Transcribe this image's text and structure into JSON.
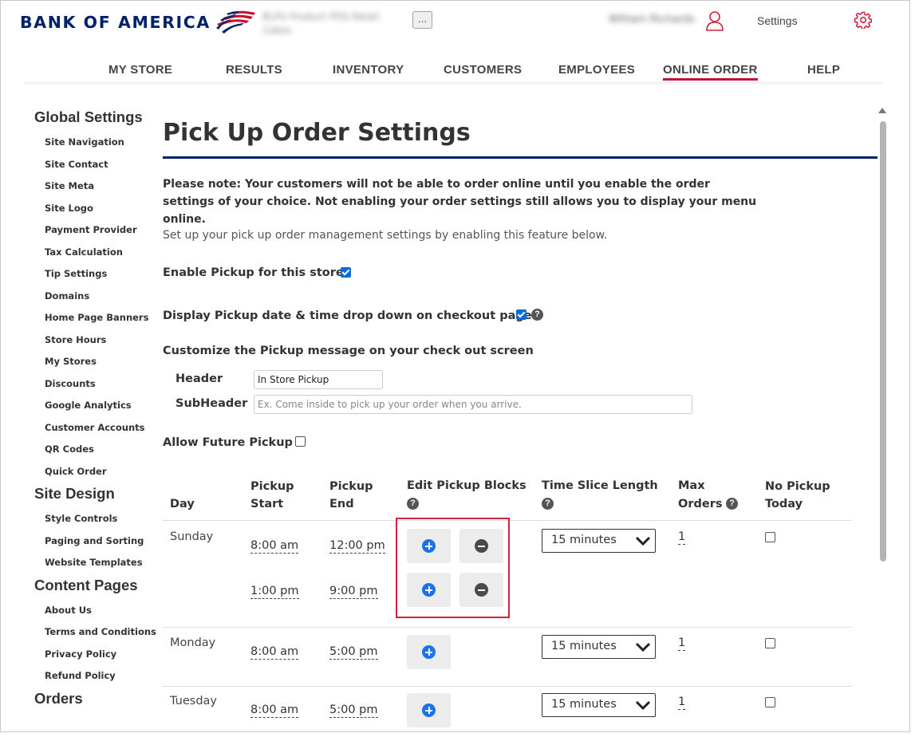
{
  "header": {
    "logo_text": "BANK OF AMERICA",
    "store_name": "BLPU Product POS Retail Cakes",
    "menu_button": "...",
    "user_name": "William Richards",
    "settings_label": "Settings",
    "brand_blue": "#012169",
    "brand_red": "#c41230"
  },
  "topnav": {
    "items": [
      "MY STORE",
      "RESULTS",
      "INVENTORY",
      "CUSTOMERS",
      "EMPLOYEES",
      "ONLINE ORDER",
      "HELP"
    ],
    "active": "ONLINE ORDER"
  },
  "sidebar": {
    "global_settings": {
      "title": "Global Settings",
      "links": [
        "Site Navigation",
        "Site Contact",
        "Site Meta",
        "Site Logo",
        "Payment Provider",
        "Tax Calculation",
        "Tip Settings",
        "Domains",
        "Home Page Banners",
        "Store Hours",
        "My Stores",
        "Discounts",
        "Google Analytics",
        "Customer Accounts",
        "QR Codes",
        "Quick Order"
      ]
    },
    "site_design": {
      "title": "Site Design",
      "links": [
        "Style Controls",
        "Paging and Sorting",
        "Website Templates"
      ]
    },
    "content_pages": {
      "title": "Content Pages",
      "links": [
        "About Us",
        "Terms and Conditions",
        "Privacy Policy",
        "Refund Policy"
      ]
    },
    "orders": {
      "title": "Orders"
    }
  },
  "main": {
    "title": "Pick Up Order Settings",
    "note": "Please note: Your customers will not be able to order online until you enable the order settings of your choice. Not enabling your order settings still allows you to display your menu online.",
    "setup_text": "Set up your pick up order management settings by enabling this feature below.",
    "enable_pickup": {
      "label": "Enable Pickup for this store?",
      "checked": true
    },
    "display_dropdown": {
      "label": "Display Pickup date & time drop down on checkout page?",
      "checked": true
    },
    "customize_label": "Customize the Pickup message on your check out screen",
    "header_field": {
      "label": "Header",
      "value": "In Store Pickup"
    },
    "subheader_field": {
      "label": "SubHeader",
      "placeholder": "Ex. Come inside to pick up your order when you arrive."
    },
    "future_pickup": {
      "label": "Allow Future Pickup",
      "checked": false
    },
    "help_glyph": "?"
  },
  "table": {
    "headers": {
      "day": "Day",
      "start_1": "Pickup",
      "start_2": "Start",
      "end_1": "Pickup",
      "end_2": "End",
      "blocks": "Edit Pickup Blocks",
      "slice": "Time Slice Length",
      "max_1": "Max",
      "max_2": "Orders",
      "nopickup_1": "No Pickup",
      "nopickup_2": "Today"
    },
    "rows": [
      {
        "day": "Sunday",
        "blocks": [
          {
            "start": "8:00 am",
            "end": "12:00 pm"
          },
          {
            "start": "1:00 pm",
            "end": "9:00 pm"
          }
        ],
        "slice": "15 minutes",
        "max_orders": "1",
        "no_pickup": false
      },
      {
        "day": "Monday",
        "blocks": [
          {
            "start": "8:00 am",
            "end": "5:00 pm"
          }
        ],
        "slice": "15 minutes",
        "max_orders": "1",
        "no_pickup": false
      },
      {
        "day": "Tuesday",
        "blocks": [
          {
            "start": "8:00 am",
            "end": "5:00 pm"
          }
        ],
        "slice": "15 minutes",
        "max_orders": "1",
        "no_pickup": false
      }
    ]
  }
}
